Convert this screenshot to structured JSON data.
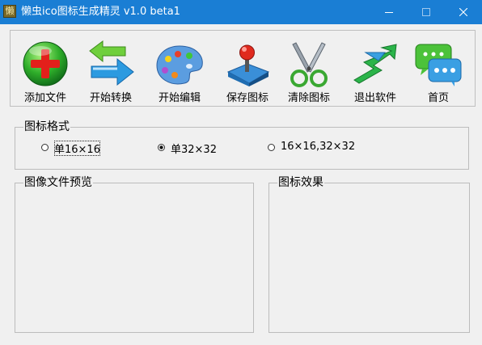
{
  "window": {
    "title": "懒虫ico图标生成精灵 v1.0 beta1",
    "app_icon_char": "懒",
    "minimize_icon": "minimize-icon",
    "maximize_icon": "maximize-icon",
    "close_icon": "close-icon"
  },
  "toolbar": {
    "items": [
      {
        "label": "添加文件",
        "icon": "add-file-icon"
      },
      {
        "label": "开始转换",
        "icon": "convert-arrows-icon"
      },
      {
        "label": "开始编辑",
        "icon": "paint-palette-icon"
      },
      {
        "label": "保存图标",
        "icon": "joystick-save-icon"
      },
      {
        "label": "清除图标",
        "icon": "scissors-icon"
      },
      {
        "label": "退出软件",
        "icon": "exit-arrow-icon"
      },
      {
        "label": "首页",
        "icon": "chat-home-icon"
      }
    ]
  },
  "format_group": {
    "title": "图标格式",
    "options": [
      {
        "label": "单16×16",
        "selected": false
      },
      {
        "label": "单32×32",
        "selected": true
      },
      {
        "label": "16×16,32×32",
        "selected": false
      }
    ]
  },
  "preview_group": {
    "title": "图像文件预览"
  },
  "effect_group": {
    "title": "图标效果"
  },
  "colors": {
    "titlebar": "#1a7ed4",
    "window_bg": "#f0f0f0",
    "group_border": "#bcbcbc"
  }
}
